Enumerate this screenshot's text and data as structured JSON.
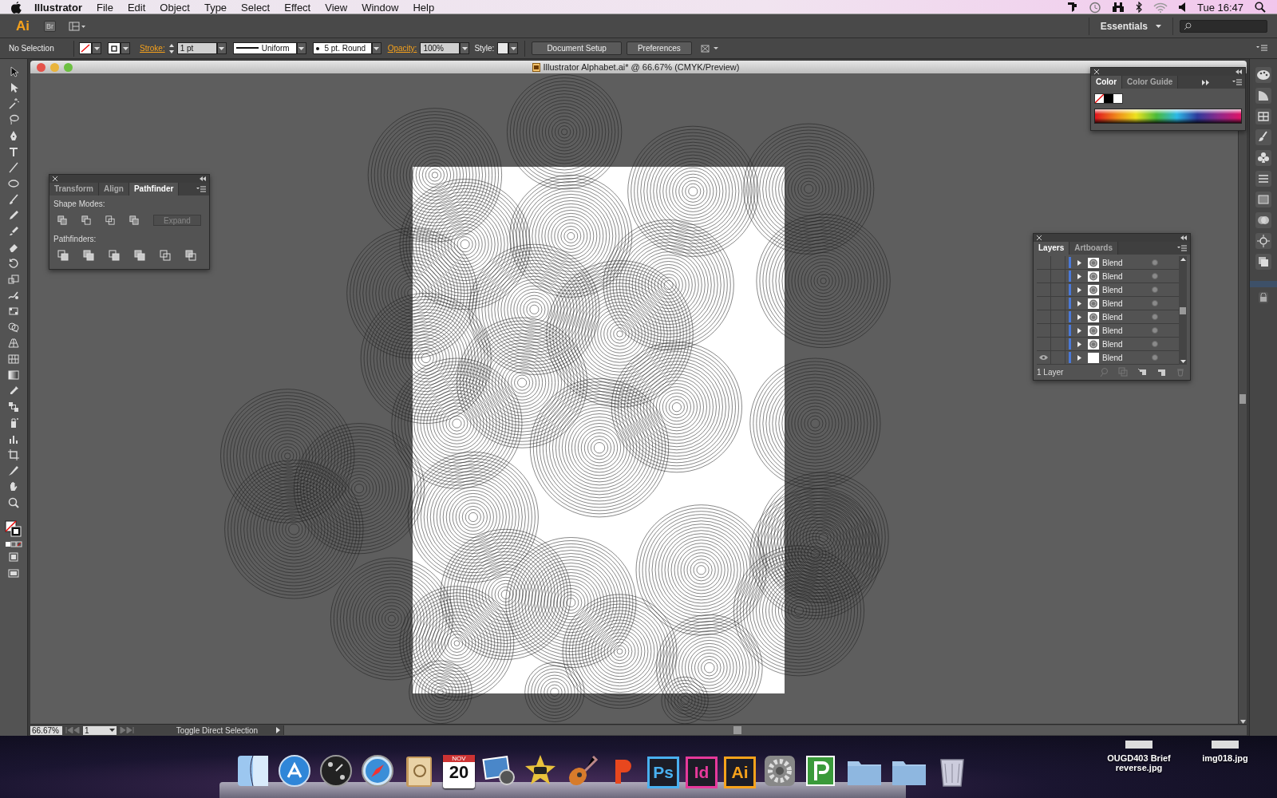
{
  "menu_bar": {
    "app_name": "Illustrator",
    "menus": [
      "File",
      "Edit",
      "Object",
      "Type",
      "Select",
      "Effect",
      "View",
      "Window",
      "Help"
    ],
    "clock": "Tue 16:47"
  },
  "app_bar": {
    "logo": "Ai",
    "bridge": "Br",
    "workspace": "Essentials"
  },
  "control_bar": {
    "selection": "No Selection",
    "stroke_label": "Stroke:",
    "stroke_weight": "1 pt",
    "profile": "Uniform",
    "brush": "5 pt. Round",
    "opacity_label": "Opacity:",
    "opacity": "100%",
    "style_label": "Style:",
    "buttons": [
      "Document Setup",
      "Preferences"
    ]
  },
  "document": {
    "title": "Illustrator Alphabet.ai* @ 66.67% (CMYK/Preview)"
  },
  "pathfinder_panel": {
    "tabs": [
      {
        "label": "Transform",
        "selected": false
      },
      {
        "label": "Align",
        "selected": false
      },
      {
        "label": "Pathfinder",
        "selected": true
      }
    ],
    "shape_modes_label": "Shape Modes:",
    "expand_button": {
      "label": "Expand",
      "disabled": true
    },
    "pathfinders_label": "Pathfinders:"
  },
  "color_panel": {
    "tabs": [
      {
        "label": "Color",
        "selected": true
      },
      {
        "label": "Color Guide",
        "selected": false
      }
    ]
  },
  "layers_panel": {
    "tabs": [
      {
        "label": "Layers",
        "selected": true
      },
      {
        "label": "Artboards",
        "selected": false
      }
    ],
    "rows": [
      {
        "name": "Blend",
        "visible": false,
        "kind": "blend"
      },
      {
        "name": "Blend",
        "visible": false,
        "kind": "blend"
      },
      {
        "name": "Blend",
        "visible": false,
        "kind": "blend"
      },
      {
        "name": "Blend",
        "visible": false,
        "kind": "blend"
      },
      {
        "name": "Blend",
        "visible": false,
        "kind": "blend"
      },
      {
        "name": "Blend",
        "visible": false,
        "kind": "blend"
      },
      {
        "name": "Blend",
        "visible": false,
        "kind": "blend"
      },
      {
        "name": "Blend",
        "visible": true,
        "kind": "blank"
      }
    ],
    "count": "1 Layer"
  },
  "status_bar": {
    "zoom": "66.67%",
    "artboard": "1",
    "tool": "Toggle Direct Selection"
  },
  "dock": {
    "apps": [
      {
        "kind": "finder"
      },
      {
        "kind": "appstore"
      },
      {
        "kind": "dashboard"
      },
      {
        "kind": "safari"
      },
      {
        "kind": "contacts"
      },
      {
        "kind": "calendar",
        "label": "NOV",
        "day": "20"
      },
      {
        "kind": "photos"
      },
      {
        "kind": "movie"
      },
      {
        "kind": "guitar"
      },
      {
        "kind": "p-app"
      },
      {
        "kind": "tile",
        "label": "Ps",
        "color": "#49b0f0"
      },
      {
        "kind": "tile",
        "label": "Id",
        "color": "#e6399b"
      },
      {
        "kind": "tile",
        "label": "Ai",
        "color": "#f7a21b"
      },
      {
        "kind": "gear"
      },
      {
        "kind": "green-p"
      },
      {
        "kind": "folder"
      },
      {
        "kind": "folder"
      },
      {
        "kind": "trash"
      }
    ],
    "files": [
      {
        "name": "OUGD403 Brief reverse.jpg"
      },
      {
        "name": "img018.jpg"
      }
    ]
  }
}
